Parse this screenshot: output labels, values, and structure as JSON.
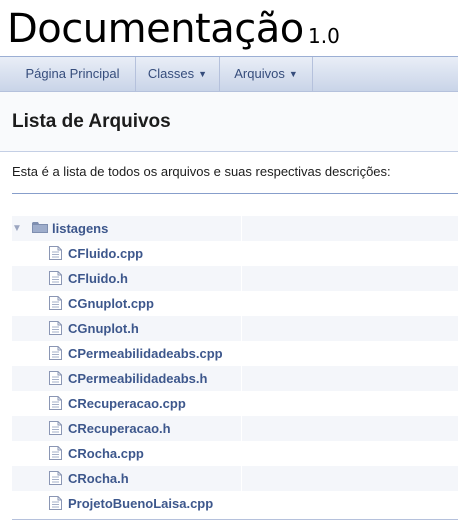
{
  "project": {
    "name": "Documentação",
    "number": "1.0"
  },
  "nav": {
    "main_page": "Página Principal",
    "classes": "Classes",
    "files": "Arquivos"
  },
  "header": {
    "title": "Lista de Arquivos"
  },
  "description": "Esta é a lista de todos os arquivos e suas respectivas descrições:",
  "tree": {
    "folder": {
      "label": "listagens",
      "icon": "folder-icon",
      "expanded": true
    },
    "files": [
      {
        "label": "CFluido.cpp",
        "icon": "file-icon"
      },
      {
        "label": "CFluido.h",
        "icon": "file-icon"
      },
      {
        "label": "CGnuplot.cpp",
        "icon": "file-icon"
      },
      {
        "label": "CGnuplot.h",
        "icon": "file-icon"
      },
      {
        "label": "CPermeabilidadeabs.cpp",
        "icon": "file-icon"
      },
      {
        "label": "CPermeabilidadeabs.h",
        "icon": "file-icon"
      },
      {
        "label": "CRecuperacao.cpp",
        "icon": "file-icon"
      },
      {
        "label": "CRecuperacao.h",
        "icon": "file-icon"
      },
      {
        "label": "CRocha.cpp",
        "icon": "file-icon"
      },
      {
        "label": "CRocha.h",
        "icon": "file-icon"
      },
      {
        "label": "ProjetoBuenoLaisa.cpp",
        "icon": "file-icon"
      }
    ]
  },
  "colors": {
    "link": "#3d578c",
    "nav_text": "#364d7c",
    "row_alt": "#f4f6fa"
  }
}
